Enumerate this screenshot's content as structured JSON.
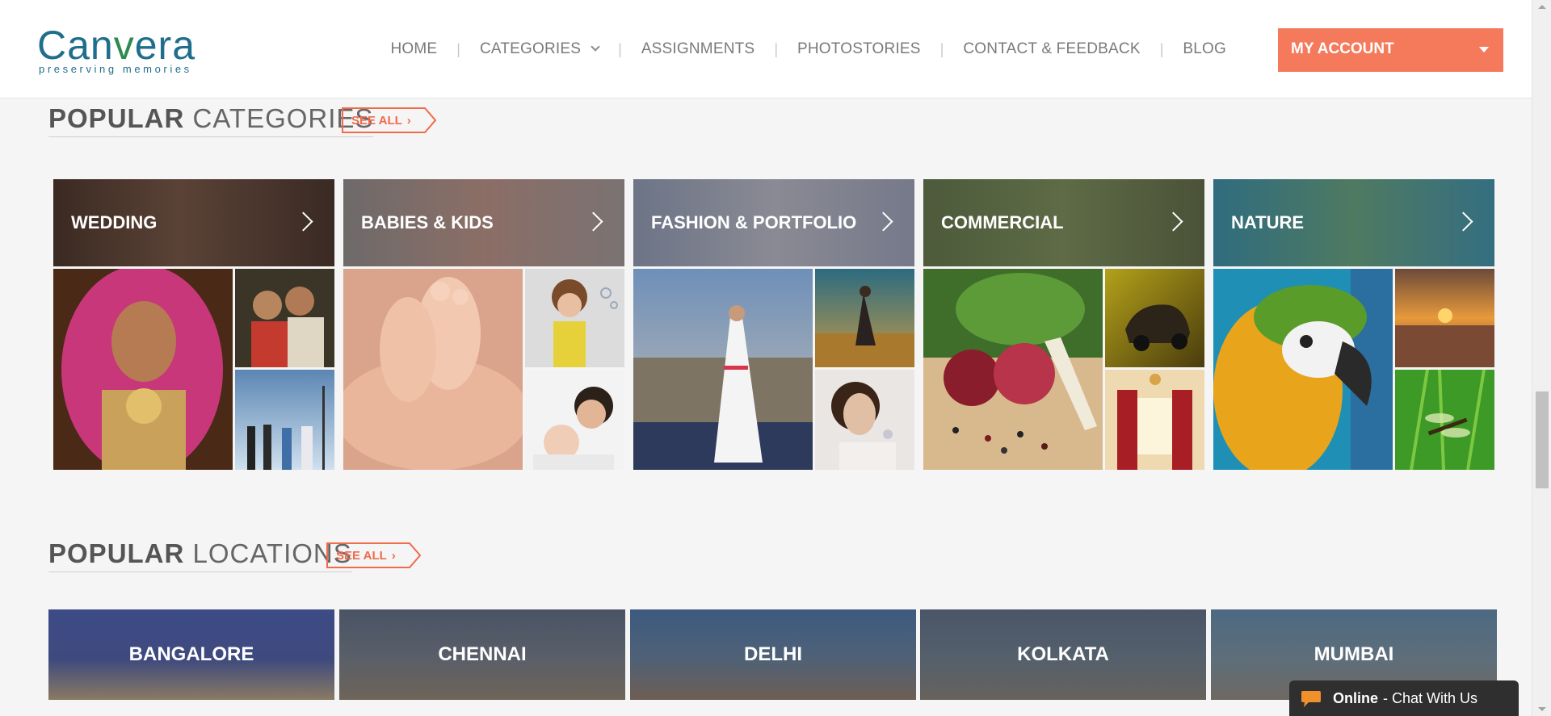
{
  "header": {
    "logo": {
      "name": "Canvera",
      "tagline": "preserving memories"
    },
    "nav": [
      {
        "label": "HOME"
      },
      {
        "label": "CATEGORIES"
      },
      {
        "label": "ASSIGNMENTS"
      },
      {
        "label": "PHOTOSTORIES"
      },
      {
        "label": "CONTACT & FEEDBACK"
      },
      {
        "label": "BLOG"
      }
    ],
    "account_label": "MY ACCOUNT"
  },
  "popular_categories": {
    "title_bold": "POPULAR",
    "title_rest": "CATEGORIES",
    "see_all": "SEE ALL",
    "items": [
      {
        "label": "WEDDING",
        "photos": [
          "bride-portrait",
          "couple-portrait",
          "wedding-party-walk"
        ]
      },
      {
        "label": "BABIES & KIDS",
        "photos": [
          "baby-feet-in-hands",
          "girl-blowing-bubbles",
          "father-kissing-baby"
        ]
      },
      {
        "label": "FASHION & PORTFOLIO",
        "photos": [
          "woman-playing-violin-rooftop",
          "woman-in-field",
          "jewellery-model"
        ]
      },
      {
        "label": "COMMERCIAL",
        "photos": [
          "onion-and-peppercorns",
          "car",
          "interior-with-red-curtains"
        ]
      },
      {
        "label": "NATURE",
        "photos": [
          "macaw-parrot",
          "sunset-beach",
          "dragonfly-on-grass"
        ]
      }
    ]
  },
  "popular_locations": {
    "title_bold": "POPULAR",
    "title_rest": "LOCATIONS",
    "see_all": "SEE ALL",
    "items": [
      {
        "label": "BANGALORE"
      },
      {
        "label": "CHENNAI"
      },
      {
        "label": "DELHI"
      },
      {
        "label": "KOLKATA"
      },
      {
        "label": "MUMBAI"
      }
    ]
  },
  "chat": {
    "status": "Online",
    "text": "- Chat With Us"
  },
  "colors": {
    "accent": "#f57a5c",
    "see_all": "#f16a4c",
    "logo_blue": "#1f6e8c",
    "logo_green": "#2f8a4e"
  }
}
